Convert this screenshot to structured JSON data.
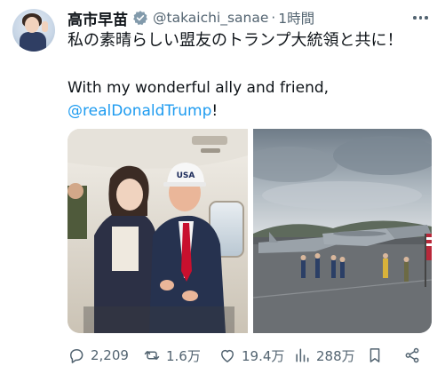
{
  "author": {
    "display_name": "高市早苗",
    "handle": "@takaichi_sanae",
    "separator": "·",
    "time": "1時間"
  },
  "tweet": {
    "line1": "私の素晴らしい盟友のトランプ大統領と共に！",
    "line2": "With my wonderful ally and friend,",
    "mention": "@realDonaldTrump",
    "mention_suffix": "!"
  },
  "media": {
    "left_cap_text": "USA"
  },
  "stats": {
    "replies": "2,209",
    "reposts": "1.6万",
    "likes": "19.4万",
    "views": "288万"
  },
  "colors": {
    "accent": "#1d9bf0",
    "text_secondary": "#536471",
    "verified_badge": "#829aab"
  },
  "icons": [
    "verified-icon",
    "more-icon",
    "reply-icon",
    "repost-icon",
    "like-icon",
    "views-icon",
    "bookmark-icon",
    "share-icon"
  ]
}
